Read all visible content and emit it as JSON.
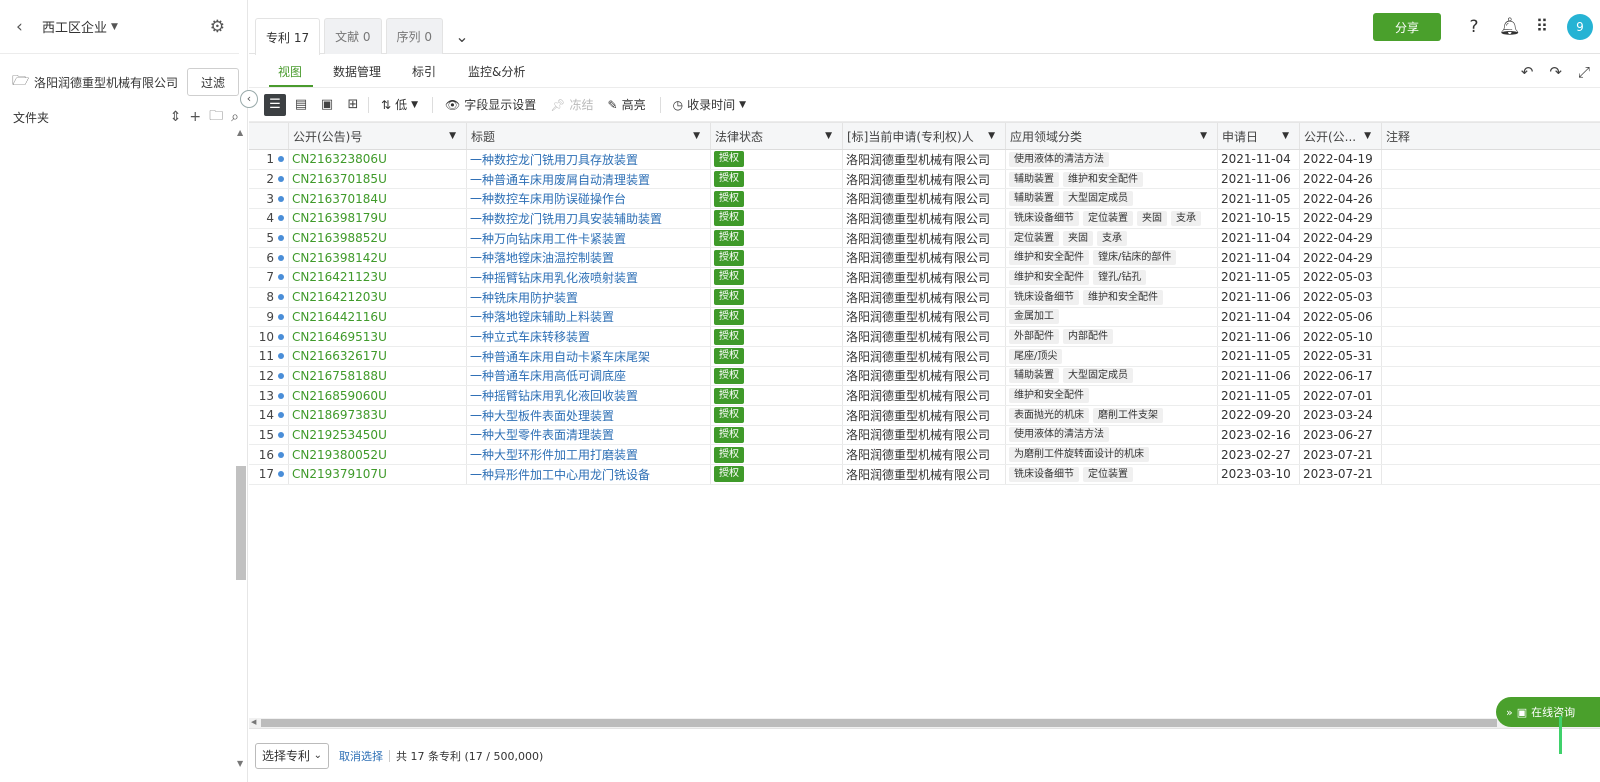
{
  "sidebar": {
    "workspace": "西工区企业",
    "company": "洛阳润德重型机械有限公司",
    "filter_label": "过滤",
    "folder_label": "文件夹"
  },
  "tabs": [
    {
      "label": "专利 17",
      "active": true
    },
    {
      "label": "文献 0",
      "active": false
    },
    {
      "label": "序列 0",
      "active": false
    }
  ],
  "header": {
    "share_label": "分享",
    "avatar_text": "9"
  },
  "subnav": [
    "视图",
    "数据管理",
    "标引",
    "监控&分析"
  ],
  "toolbar": {
    "density_label": "低",
    "field_settings_label": "字段显示设置",
    "freeze_label": "冻结",
    "highlight_label": "高亮",
    "sort_label": "收录时间"
  },
  "columns": [
    "公开(公告)号",
    "标题",
    "法律状态",
    "[标]当前申请(专利权)人",
    "应用领域分类",
    "申请日",
    "公开(公...",
    "注释"
  ],
  "rows": [
    {
      "n": "1",
      "pub": "CN216323806U",
      "title": "一种数控龙门铣用刀具存放装置",
      "status": "授权",
      "app": "洛阳润德重型机械有限公司",
      "fields": [
        "使用液体的清洁方法"
      ],
      "d1": "2021-11-04",
      "d2": "2022-04-19"
    },
    {
      "n": "2",
      "pub": "CN216370185U",
      "title": "一种普通车床用废屑自动清理装置",
      "status": "授权",
      "app": "洛阳润德重型机械有限公司",
      "fields": [
        "辅助装置",
        "维护和安全配件"
      ],
      "d1": "2021-11-06",
      "d2": "2022-04-26"
    },
    {
      "n": "3",
      "pub": "CN216370184U",
      "title": "一种数控车床用防误碰操作台",
      "status": "授权",
      "app": "洛阳润德重型机械有限公司",
      "fields": [
        "辅助装置",
        "大型固定成员"
      ],
      "d1": "2021-11-05",
      "d2": "2022-04-26"
    },
    {
      "n": "4",
      "pub": "CN216398179U",
      "title": "一种数控龙门铣用刀具安装辅助装置",
      "status": "授权",
      "app": "洛阳润德重型机械有限公司",
      "fields": [
        "铣床设备细节",
        "定位装置",
        "夹固",
        "支承"
      ],
      "d1": "2021-10-15",
      "d2": "2022-04-29"
    },
    {
      "n": "5",
      "pub": "CN216398852U",
      "title": "一种万向钻床用工件卡紧装置",
      "status": "授权",
      "app": "洛阳润德重型机械有限公司",
      "fields": [
        "定位装置",
        "夹固",
        "支承"
      ],
      "d1": "2021-11-04",
      "d2": "2022-04-29"
    },
    {
      "n": "6",
      "pub": "CN216398142U",
      "title": "一种落地镗床油温控制装置",
      "status": "授权",
      "app": "洛阳润德重型机械有限公司",
      "fields": [
        "维护和安全配件",
        "镗床/钻床的部件"
      ],
      "d1": "2021-11-04",
      "d2": "2022-04-29"
    },
    {
      "n": "7",
      "pub": "CN216421123U",
      "title": "一种摇臂钻床用乳化液喷射装置",
      "status": "授权",
      "app": "洛阳润德重型机械有限公司",
      "fields": [
        "维护和安全配件",
        "镗孔/钻孔"
      ],
      "d1": "2021-11-05",
      "d2": "2022-05-03"
    },
    {
      "n": "8",
      "pub": "CN216421203U",
      "title": "一种铣床用防护装置",
      "status": "授权",
      "app": "洛阳润德重型机械有限公司",
      "fields": [
        "铣床设备细节",
        "维护和安全配件"
      ],
      "d1": "2021-11-06",
      "d2": "2022-05-03"
    },
    {
      "n": "9",
      "pub": "CN216442116U",
      "title": "一种落地镗床辅助上料装置",
      "status": "授权",
      "app": "洛阳润德重型机械有限公司",
      "fields": [
        "金属加工"
      ],
      "d1": "2021-11-04",
      "d2": "2022-05-06"
    },
    {
      "n": "10",
      "pub": "CN216469513U",
      "title": "一种立式车床转移装置",
      "status": "授权",
      "app": "洛阳润德重型机械有限公司",
      "fields": [
        "外部配件",
        "内部配件"
      ],
      "d1": "2021-11-06",
      "d2": "2022-05-10"
    },
    {
      "n": "11",
      "pub": "CN216632617U",
      "title": "一种普通车床用自动卡紧车床尾架",
      "status": "授权",
      "app": "洛阳润德重型机械有限公司",
      "fields": [
        "尾座/顶尖"
      ],
      "d1": "2021-11-05",
      "d2": "2022-05-31"
    },
    {
      "n": "12",
      "pub": "CN216758188U",
      "title": "一种普通车床用高低可调底座",
      "status": "授权",
      "app": "洛阳润德重型机械有限公司",
      "fields": [
        "辅助装置",
        "大型固定成员"
      ],
      "d1": "2021-11-06",
      "d2": "2022-06-17"
    },
    {
      "n": "13",
      "pub": "CN216859060U",
      "title": "一种摇臂钻床用乳化液回收装置",
      "status": "授权",
      "app": "洛阳润德重型机械有限公司",
      "fields": [
        "维护和安全配件"
      ],
      "d1": "2021-11-05",
      "d2": "2022-07-01"
    },
    {
      "n": "14",
      "pub": "CN218697383U",
      "title": "一种大型板件表面处理装置",
      "status": "授权",
      "app": "洛阳润德重型机械有限公司",
      "fields": [
        "表面抛光的机床",
        "磨削工件支架"
      ],
      "d1": "2022-09-20",
      "d2": "2023-03-24"
    },
    {
      "n": "15",
      "pub": "CN219253450U",
      "title": "一种大型零件表面清理装置",
      "status": "授权",
      "app": "洛阳润德重型机械有限公司",
      "fields": [
        "使用液体的清洁方法"
      ],
      "d1": "2023-02-16",
      "d2": "2023-06-27"
    },
    {
      "n": "16",
      "pub": "CN219380052U",
      "title": "一种大型环形件加工用打磨装置",
      "status": "授权",
      "app": "洛阳润德重型机械有限公司",
      "fields": [
        "为磨削工件旋转面设计的机床"
      ],
      "d1": "2023-02-27",
      "d2": "2023-07-21"
    },
    {
      "n": "17",
      "pub": "CN219379107U",
      "title": "一种异形件加工中心用龙门铣设备",
      "status": "授权",
      "app": "洛阳润德重型机械有限公司",
      "fields": [
        "铣床设备细节",
        "定位装置"
      ],
      "d1": "2023-03-10",
      "d2": "2023-07-21"
    }
  ],
  "footer": {
    "select_label": "选择专利",
    "cancel_label": "取消选择",
    "count_text": "共 17 条专利 (17 / 500,000)"
  },
  "chat_label": "在线咨询",
  "colors": {
    "brand_green": "#4aa02c",
    "link_blue": "#2d6fb5",
    "avatar": "#26b3d4"
  }
}
